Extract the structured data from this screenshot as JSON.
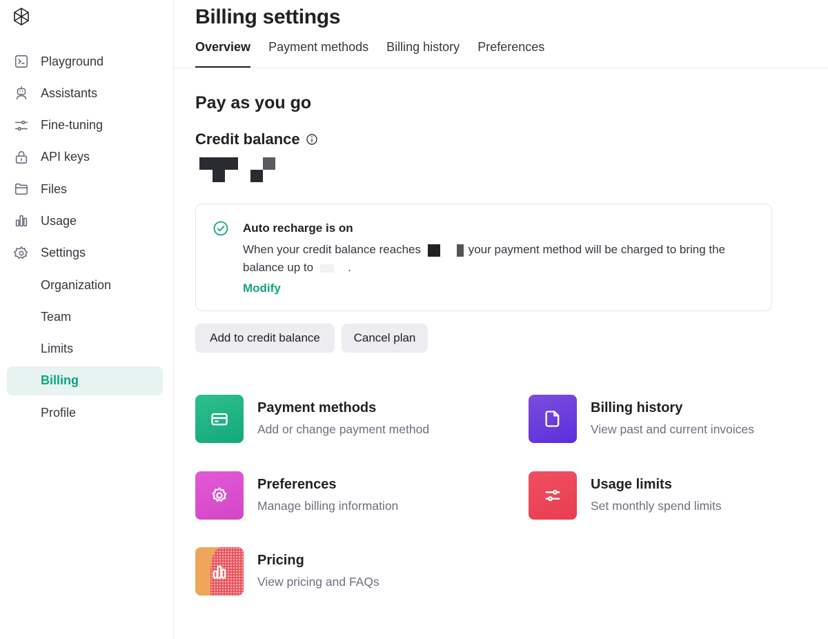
{
  "sidebar": {
    "logo": "openai-logo",
    "items": [
      {
        "label": "Playground",
        "icon": "terminal-icon"
      },
      {
        "label": "Assistants",
        "icon": "robot-icon"
      },
      {
        "label": "Fine-tuning",
        "icon": "sliders-icon"
      },
      {
        "label": "API keys",
        "icon": "lock-icon"
      },
      {
        "label": "Files",
        "icon": "folder-icon"
      },
      {
        "label": "Usage",
        "icon": "bar-chart-icon"
      },
      {
        "label": "Settings",
        "icon": "gear-icon"
      }
    ],
    "settings_items": [
      "Organization",
      "Team",
      "Limits",
      "Billing",
      "Profile"
    ],
    "active": "Billing"
  },
  "header": {
    "title": "Billing settings",
    "tabs": [
      "Overview",
      "Payment methods",
      "Billing history",
      "Preferences"
    ],
    "active_tab": "Overview"
  },
  "main": {
    "section_title": "Pay as you go",
    "credit_title": "Credit balance",
    "recharge": {
      "title": "Auto recharge is on",
      "text_before": "When your credit balance reaches",
      "text_middle": "your payment method will be charged to bring the balance up to",
      "text_end": ".",
      "modify": "Modify"
    },
    "buttons": {
      "add": "Add to credit balance",
      "cancel": "Cancel plan"
    },
    "tiles": [
      {
        "title": "Payment methods",
        "desc": "Add or change payment method",
        "icon": "credit-card-icon",
        "color": "#1fb386"
      },
      {
        "title": "Billing history",
        "desc": "View past and current invoices",
        "icon": "document-icon",
        "color": "#6c3ee0"
      },
      {
        "title": "Preferences",
        "desc": "Manage billing information",
        "icon": "gear-icon",
        "color": "#dc4fcf"
      },
      {
        "title": "Usage limits",
        "desc": "Set monthly spend limits",
        "icon": "sliders-icon",
        "color": "#ed4659"
      },
      {
        "title": "Pricing",
        "desc": "View pricing and FAQs",
        "icon": "bar-chart-icon",
        "color": "#efa55a"
      }
    ]
  },
  "colors": {
    "accent": "#10a37f",
    "active_bg": "#e6f3f1",
    "button_bg": "#ececf1"
  }
}
